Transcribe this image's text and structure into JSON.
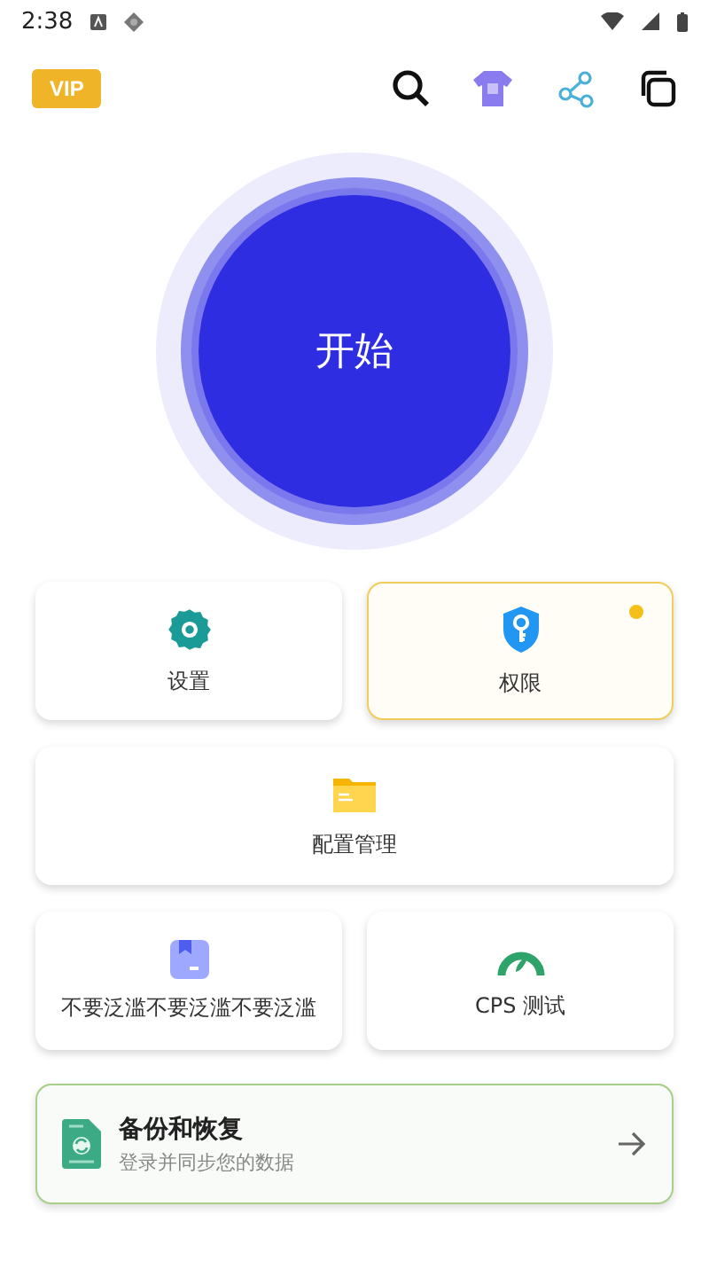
{
  "status_bar": {
    "time": "2:38"
  },
  "header": {
    "vip_badge": "VIP"
  },
  "start_button": {
    "label": "开始"
  },
  "tiles": [
    {
      "label": "设置",
      "highlighted": false,
      "dot": false,
      "wide": false
    },
    {
      "label": "权限",
      "highlighted": true,
      "dot": true,
      "wide": false
    },
    {
      "label": "配置管理",
      "highlighted": false,
      "dot": false,
      "wide": true
    },
    {
      "label": "不要泛滥不要泛滥不要泛滥",
      "highlighted": false,
      "dot": false,
      "wide": false
    },
    {
      "label": "CPS 测试",
      "highlighted": false,
      "dot": false,
      "wide": false
    }
  ],
  "backup_card": {
    "title": "备份和恢复",
    "subtitle": "登录并同步您的数据"
  }
}
